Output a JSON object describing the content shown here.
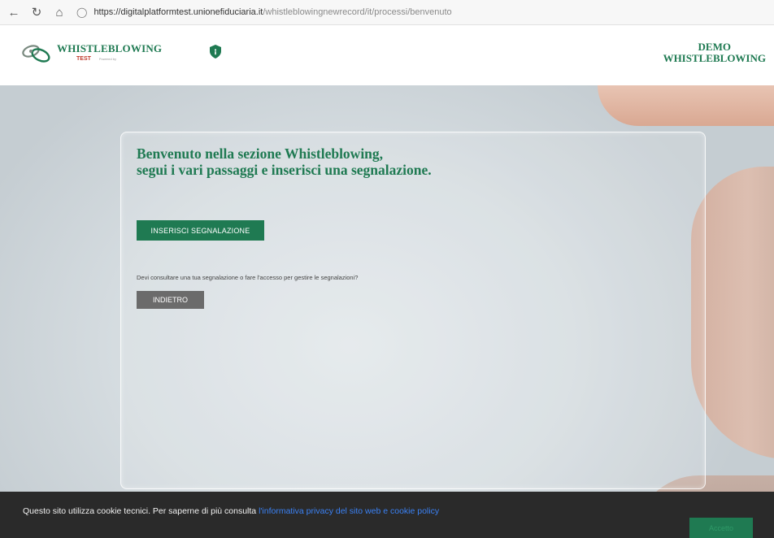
{
  "browser": {
    "back_icon": "arrow-left-icon",
    "refresh_icon": "refresh-icon",
    "home_icon": "home-icon",
    "url_domain": "https://digitalplatformtest.unionefiduciaria.it",
    "url_path": "/whistleblowingnewrecord/it/processi/benvenuto"
  },
  "header": {
    "logo_title": "WHISTLEBLOWING",
    "logo_test": "TEST",
    "logo_powered": "Powered by",
    "shield_icon": "shield-icon",
    "demo_line1": "DEMO",
    "demo_line2": "WHISTLEBLOWING"
  },
  "main": {
    "welcome_line1": "Benvenuto nella sezione Whistleblowing,",
    "welcome_line2": "segui i vari passaggi e inserisci una segnalazione.",
    "insert_button": "INSERISCI SEGNALAZIONE",
    "question": "Devi consultare una tua segnalazione o fare l'accesso per gestire le segnalazioni?",
    "back_button": "INDIETRO"
  },
  "cookie": {
    "text": "Questo sito utilizza cookie tecnici. Per saperne di più consulta",
    "link": "l'informativa privacy del sito web e cookie policy",
    "accept": "Accetto"
  },
  "colors": {
    "brand_green": "#1f7a52",
    "button_gray": "#6b6b6b",
    "cookie_bg": "#2a2a2a",
    "link_blue": "#3b82f6"
  }
}
